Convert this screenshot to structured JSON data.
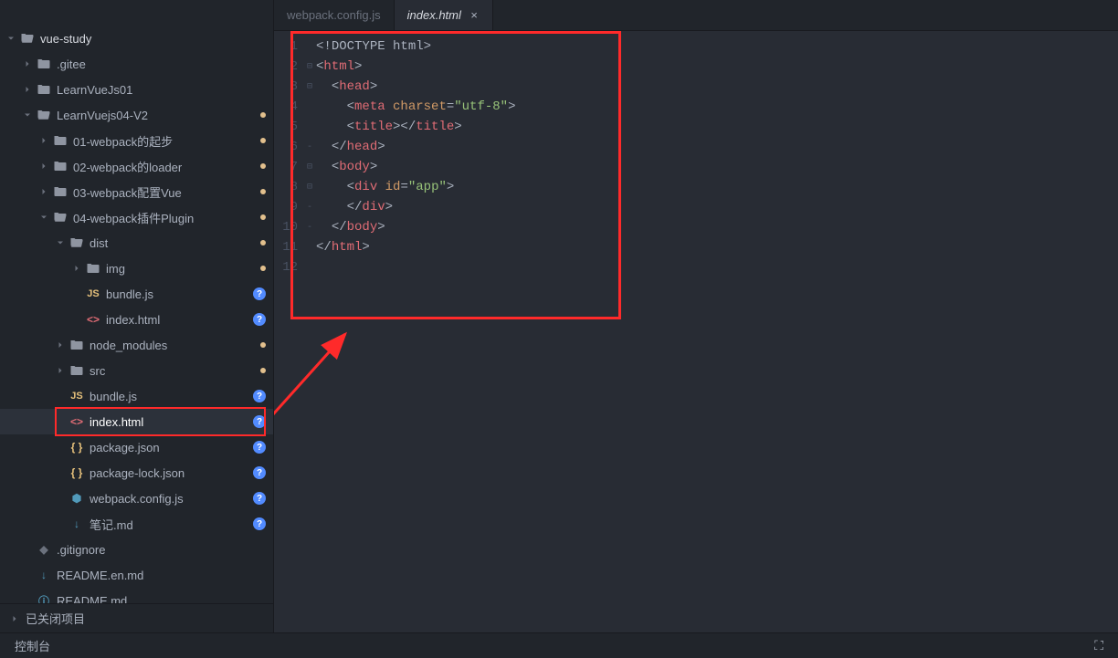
{
  "tree": {
    "root": "vue-study",
    "items": [
      {
        "label": ".gitee",
        "type": "folder",
        "indent": 1,
        "expanded": false
      },
      {
        "label": "LearnVueJs01",
        "type": "folder",
        "indent": 1,
        "expanded": false
      },
      {
        "label": "LearnVuejs04-V2",
        "type": "folder-open",
        "indent": 1,
        "expanded": true,
        "status": "dot"
      },
      {
        "label": "01-webpack的起步",
        "type": "folder",
        "indent": 2,
        "expanded": false,
        "status": "dot"
      },
      {
        "label": "02-webpack的loader",
        "type": "folder",
        "indent": 2,
        "expanded": false,
        "status": "dot"
      },
      {
        "label": "03-webpack配置Vue",
        "type": "folder",
        "indent": 2,
        "expanded": false,
        "status": "dot"
      },
      {
        "label": "04-webpack插件Plugin",
        "type": "folder-open",
        "indent": 2,
        "expanded": true,
        "status": "dot"
      },
      {
        "label": "dist",
        "type": "folder-open",
        "indent": 3,
        "expanded": true,
        "status": "dot"
      },
      {
        "label": "img",
        "type": "folder",
        "indent": 4,
        "expanded": false,
        "status": "dot"
      },
      {
        "label": "bundle.js",
        "type": "js",
        "indent": 4,
        "status": "info"
      },
      {
        "label": "index.html",
        "type": "html",
        "indent": 4,
        "status": "info"
      },
      {
        "label": "node_modules",
        "type": "folder",
        "indent": 3,
        "expanded": false,
        "status": "dot"
      },
      {
        "label": "src",
        "type": "folder",
        "indent": 3,
        "expanded": false,
        "status": "dot"
      },
      {
        "label": "bundle.js",
        "type": "js",
        "indent": 3,
        "status": "info"
      },
      {
        "label": "index.html",
        "type": "html",
        "indent": 3,
        "status": "info",
        "selected": true,
        "redbox": true
      },
      {
        "label": "package.json",
        "type": "json",
        "indent": 3,
        "status": "info"
      },
      {
        "label": "package-lock.json",
        "type": "json",
        "indent": 3,
        "status": "info"
      },
      {
        "label": "webpack.config.js",
        "type": "webpack",
        "indent": 3,
        "status": "info"
      },
      {
        "label": "笔记.md",
        "type": "md",
        "indent": 3,
        "status": "info"
      },
      {
        "label": ".gitignore",
        "type": "gitignore",
        "indent": 1
      },
      {
        "label": "README.en.md",
        "type": "md",
        "indent": 1
      },
      {
        "label": "README.md",
        "type": "readme-cut",
        "indent": 1
      }
    ]
  },
  "closed_projects_label": "已关闭项目",
  "tabs": [
    {
      "label": "webpack.config.js",
      "active": false
    },
    {
      "label": "index.html",
      "active": true,
      "closeable": true
    }
  ],
  "code_lines": [
    {
      "n": 1,
      "html": "<span class='punct'>&lt;!</span><span class='doctype'>DOCTYPE html</span><span class='punct'>&gt;</span>",
      "indent": 0
    },
    {
      "n": 2,
      "fold": "⊟",
      "html": "<span class='punct'>&lt;</span><span class='tag'>html</span><span class='punct'>&gt;</span>",
      "indent": 0
    },
    {
      "n": 3,
      "fold": "⊟",
      "html": "<span class='punct'>&lt;</span><span class='tag'>head</span><span class='punct'>&gt;</span>",
      "indent": 1
    },
    {
      "n": 4,
      "html": "<span class='punct'>&lt;</span><span class='tag'>meta</span> <span class='attr'>charset</span><span class='punct'>=</span><span class='str'>&quot;utf-8&quot;</span><span class='punct'>&gt;</span>",
      "indent": 2
    },
    {
      "n": 5,
      "html": "<span class='punct'>&lt;</span><span class='tag'>title</span><span class='punct'>&gt;&lt;/</span><span class='tag'>title</span><span class='punct'>&gt;</span>",
      "indent": 2
    },
    {
      "n": 6,
      "fold": "-",
      "html": "<span class='punct'>&lt;/</span><span class='tag'>head</span><span class='punct'>&gt;</span>",
      "indent": 1
    },
    {
      "n": 7,
      "fold": "⊟",
      "html": "<span class='punct'>&lt;</span><span class='tag'>body</span><span class='punct'>&gt;</span>",
      "indent": 1
    },
    {
      "n": 8,
      "fold": "⊟",
      "html": "<span class='punct'>&lt;</span><span class='tag'>div</span> <span class='attr'>id</span><span class='punct'>=</span><span class='str'>&quot;app&quot;</span><span class='punct'>&gt;</span>",
      "indent": 2
    },
    {
      "n": 9,
      "fold": "-",
      "html": "<span class='punct'>&lt;/</span><span class='tag'>div</span><span class='punct'>&gt;</span>",
      "indent": 2
    },
    {
      "n": 10,
      "fold": "-",
      "html": "<span class='punct'>&lt;/</span><span class='tag'>body</span><span class='punct'>&gt;</span>",
      "indent": 1
    },
    {
      "n": 11,
      "html": "<span class='punct'>&lt;/</span><span class='tag'>html</span><span class='punct'>&gt;</span>",
      "indent": 0
    },
    {
      "n": 12,
      "html": "",
      "indent": 0
    }
  ],
  "bottom_bar": {
    "left": "控制台"
  }
}
